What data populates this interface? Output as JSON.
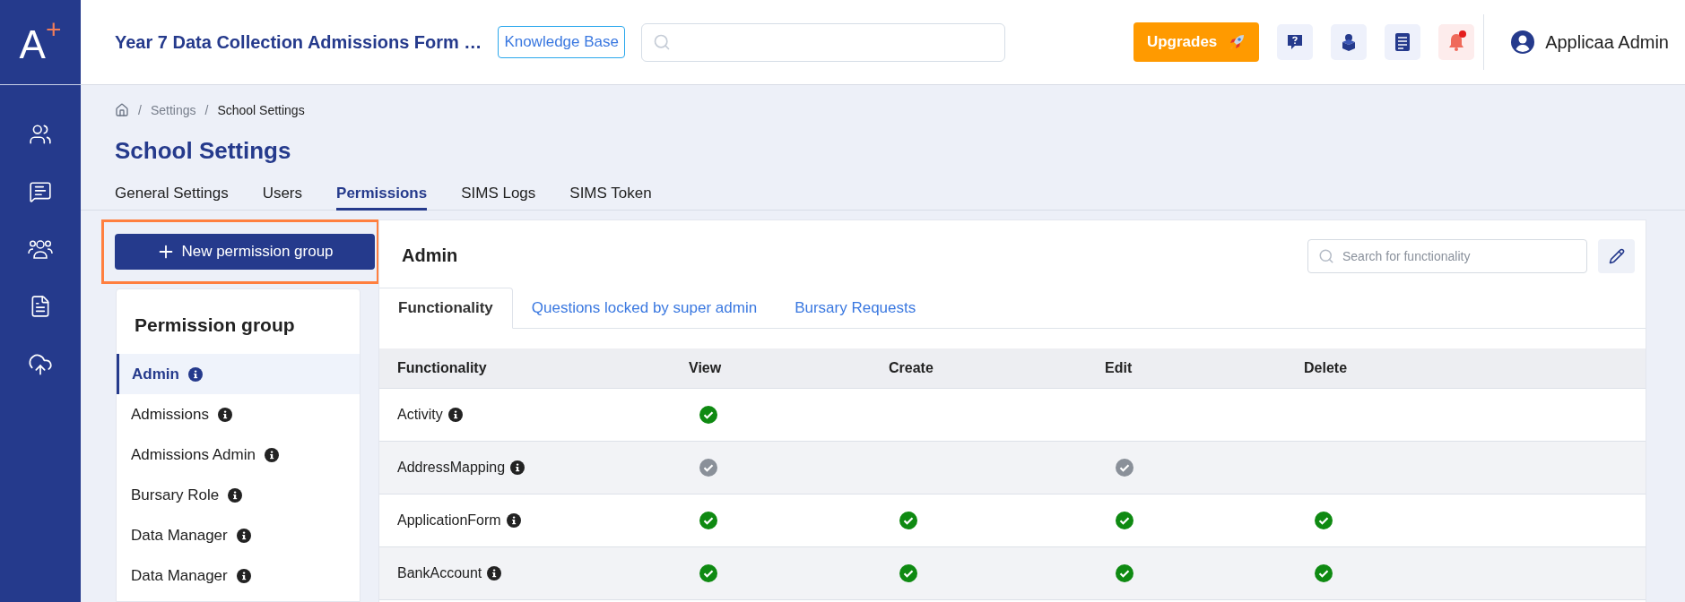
{
  "logo": {
    "letter": "A",
    "mark": "+"
  },
  "header": {
    "title": "Year 7 Data Collection Admissions Form …",
    "knowledge_base": "Knowledge Base",
    "upgrades": "Upgrades",
    "user": "Applicaa Admin",
    "notifications_unread": true
  },
  "breadcrumb": [
    {
      "separator": "/",
      "label": "Settings"
    },
    {
      "separator": "/",
      "label": "School Settings"
    }
  ],
  "page_title": "School Settings",
  "tabs": [
    {
      "label": "General Settings",
      "selected": false
    },
    {
      "label": "Users",
      "selected": false
    },
    {
      "label": "Permissions",
      "selected": true
    },
    {
      "label": "SIMS Logs",
      "selected": false
    },
    {
      "label": "SIMS Token",
      "selected": false
    }
  ],
  "new_group_button": "New permission group",
  "permission_groups": {
    "title": "Permission group",
    "items": [
      {
        "label": "Admin",
        "selected": true
      },
      {
        "label": "Admissions",
        "selected": false
      },
      {
        "label": "Admissions Admin",
        "selected": false
      },
      {
        "label": "Bursary Role",
        "selected": false
      },
      {
        "label": "Data Manager",
        "selected": false
      },
      {
        "label": "Data Manager",
        "selected": false
      }
    ]
  },
  "detail": {
    "title": "Admin",
    "search": {
      "placeholder": "Search for functionality"
    },
    "tabs": [
      {
        "label": "Functionality",
        "selected": true
      },
      {
        "label": "Questions locked by super admin",
        "selected": false
      },
      {
        "label": "Bursary Requests",
        "selected": false
      }
    ],
    "table": {
      "columns": [
        "Functionality",
        "View",
        "Create",
        "Edit",
        "Delete"
      ],
      "rows": [
        {
          "name": "Activity",
          "cells": [
            {
              "checked": true,
              "disabled": false
            },
            {
              "checked": false
            },
            {
              "checked": false
            },
            {
              "checked": false
            }
          ]
        },
        {
          "name": "AddressMapping",
          "cells": [
            {
              "checked": true,
              "disabled": true
            },
            {
              "checked": false
            },
            {
              "checked": true,
              "disabled": true
            },
            {
              "checked": false
            }
          ]
        },
        {
          "name": "ApplicationForm",
          "cells": [
            {
              "checked": true,
              "disabled": false
            },
            {
              "checked": true,
              "disabled": false
            },
            {
              "checked": true,
              "disabled": false
            },
            {
              "checked": true,
              "disabled": false
            }
          ]
        },
        {
          "name": "BankAccount",
          "cells": [
            {
              "checked": true,
              "disabled": false
            },
            {
              "checked": true,
              "disabled": false
            },
            {
              "checked": true,
              "disabled": false
            },
            {
              "checked": true,
              "disabled": false
            }
          ]
        }
      ]
    }
  }
}
